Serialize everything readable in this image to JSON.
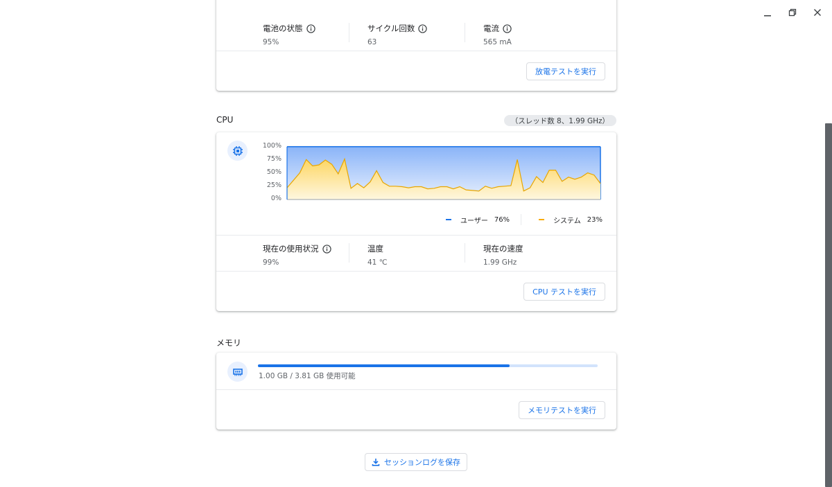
{
  "battery": {
    "metrics": [
      {
        "label": "電池の状態",
        "value": "95%",
        "has_info": true
      },
      {
        "label": "サイクル回数",
        "value": "63",
        "has_info": true
      },
      {
        "label": "電流",
        "value": "565 mA",
        "has_info": true
      }
    ],
    "test_button": "放電テストを実行"
  },
  "cpu": {
    "section_title": "CPU",
    "chip": "（スレッド数 8、1.99 GHz）",
    "icon": "cpu-chip-icon",
    "chart_data": {
      "type": "area",
      "yticks": [
        "100%",
        "75%",
        "50%",
        "25%",
        "0%"
      ],
      "ylim": [
        0,
        100
      ],
      "series": [
        {
          "name": "ユーザー",
          "color": "#1a73e8",
          "values": [
            99,
            99,
            99,
            99,
            99,
            99,
            99,
            99,
            99,
            99,
            99,
            99,
            99,
            99,
            99,
            99,
            99,
            99,
            99,
            99,
            99,
            99,
            99,
            99,
            99,
            99,
            99,
            99,
            99,
            99,
            99,
            99,
            99,
            99,
            99,
            99,
            99,
            99,
            99,
            99,
            99,
            99,
            99,
            99,
            99,
            99,
            99,
            99,
            99,
            99,
            99
          ]
        },
        {
          "name": "システム",
          "color": "#f9ab00",
          "values": [
            22,
            36,
            50,
            75,
            63,
            65,
            74,
            66,
            48,
            76,
            21,
            30,
            22,
            33,
            54,
            32,
            25,
            25,
            24,
            22,
            24,
            24,
            20,
            21,
            24,
            24,
            20,
            24,
            18,
            17,
            16,
            25,
            21,
            24,
            25,
            26,
            75,
            16,
            22,
            43,
            32,
            55,
            55,
            34,
            42,
            38,
            42,
            50,
            46,
            30
          ]
        }
      ],
      "legend": [
        {
          "name": "ユーザー",
          "value": "76%",
          "color": "#1a73e8"
        },
        {
          "name": "システム",
          "value": "23%",
          "color": "#f9ab00"
        }
      ],
      "grid": true
    },
    "metrics": [
      {
        "label": "現在の使用状況",
        "value": "99%",
        "has_info": true
      },
      {
        "label": "温度",
        "value": "41 ℃",
        "has_info": false
      },
      {
        "label": "現在の速度",
        "value": "1.99 GHz",
        "has_info": false
      }
    ],
    "test_button": "CPU テストを実行"
  },
  "memory": {
    "section_title": "メモリ",
    "icon": "memory-chip-icon",
    "usage_fraction": 0.74,
    "usage_text": "1.00 GB / 3.81 GB 使用可能",
    "test_button": "メモリテストを実行"
  },
  "save_session_log": "セッションログを保存",
  "colors": {
    "accent": "#1a73e8",
    "system": "#f9ab00"
  }
}
